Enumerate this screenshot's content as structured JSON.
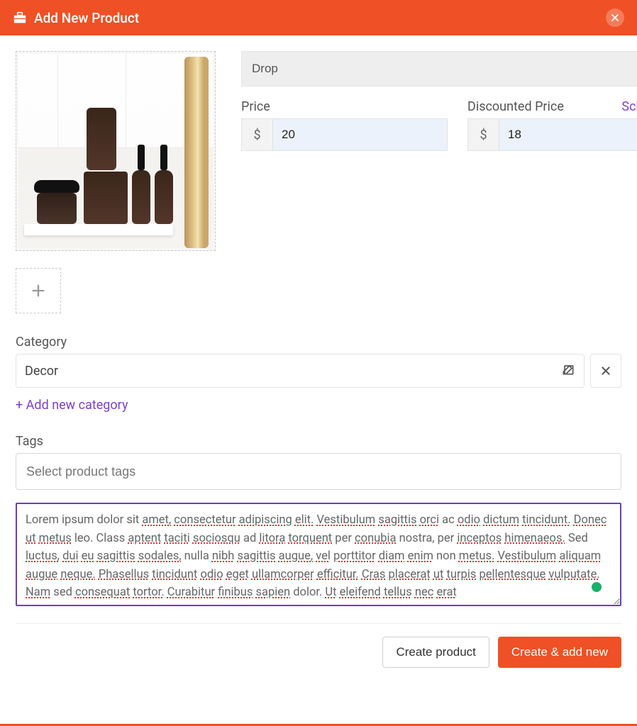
{
  "header": {
    "title": "Add New Product"
  },
  "product": {
    "name": "Drop",
    "price": {
      "label": "Price",
      "currency": "$",
      "value": "20"
    },
    "discounted": {
      "label": "Discounted Price",
      "schedule_label": "Schedule",
      "currency": "$",
      "value": "18"
    }
  },
  "category": {
    "label": "Category",
    "value": "Decor",
    "add_new_label": "+ Add new category"
  },
  "tags": {
    "label": "Tags",
    "placeholder": "Select product tags"
  },
  "description": {
    "text_plain": "Lorem ipsum dolor sit amet, consectetur adipiscing elit. Vestibulum sagittis orci ac odio dictum tincidunt. Donec ut metus leo. Class aptent taciti sociosqu ad litora torquent per conubia nostra, per inceptos himenaeos. Sed luctus, dui eu sagittis sodales, nulla nibh sagittis augue, vel porttitor diam enim non metus. Vestibulum aliquam augue neque. Phasellus tincidunt odio eget ullamcorper efficitur. Cras placerat ut turpis pellentesque vulputate. Nam sed consequat tortor. Curabitur finibus sapien dolor. Ut eleifend tellus nec erat"
  },
  "footer": {
    "create_label": "Create product",
    "create_add_label": "Create & add new"
  }
}
